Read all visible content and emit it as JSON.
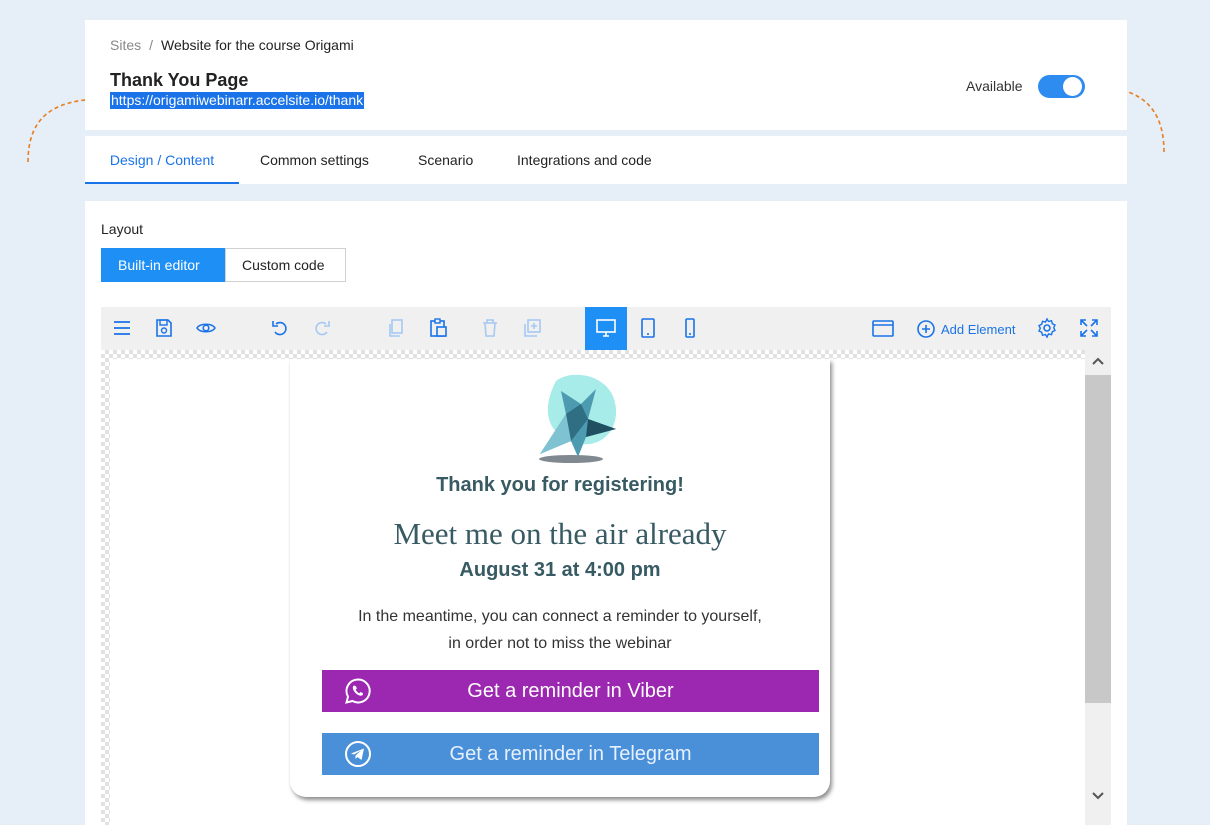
{
  "breadcrumb": {
    "root": "Sites",
    "separator": "/",
    "current": "Website for the course Origami"
  },
  "page": {
    "title": "Thank You Page",
    "url": "https://origamiwebinarr.accelsite.io/thank"
  },
  "availability": {
    "label": "Available",
    "enabled": true
  },
  "tabs": [
    {
      "label": "Design / Content",
      "active": true
    },
    {
      "label": "Common settings",
      "active": false
    },
    {
      "label": "Scenario",
      "active": false
    },
    {
      "label": "Integrations and code",
      "active": false
    }
  ],
  "layout": {
    "label": "Layout",
    "options": [
      "Built-in editor",
      "Custom code"
    ],
    "selected": "Built-in editor"
  },
  "toolbar": {
    "add_element_label": "Add Element",
    "active_device": "desktop"
  },
  "preview": {
    "heading": "Thank you for registering!",
    "subheading": "Meet me on the air already",
    "date": "August 31 at 4:00 pm",
    "description_line1": "In the meantime, you can connect a reminder to yourself,",
    "description_line2": "in order not to miss the webinar",
    "viber_button": "Get a reminder in Viber",
    "telegram_button": "Get a reminder in Telegram"
  },
  "colors": {
    "accent": "#1a73e8",
    "viber": "#9c27b0",
    "telegram": "#4a90d9",
    "heading_text": "#375a63",
    "annotation_arrow": "#e67e22"
  }
}
